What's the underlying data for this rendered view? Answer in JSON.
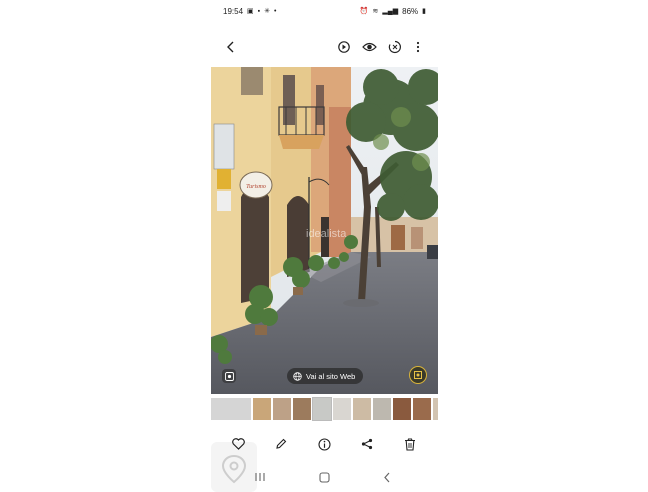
{
  "status_bar": {
    "time": "19:54",
    "battery": "86%"
  },
  "photo": {
    "watermark": "idealista",
    "web_button_label": "Vai al sito Web"
  },
  "thumbnails": {
    "count": 10,
    "active_index": 3
  },
  "top_bar": {
    "icons": [
      "back-icon",
      "rotate-icon",
      "eye-icon",
      "remaster-icon",
      "more-icon"
    ]
  },
  "action_bar": {
    "icons": [
      "heart-icon",
      "edit-icon",
      "info-icon",
      "share-icon",
      "delete-icon"
    ]
  },
  "nav_bar": {
    "icons": [
      "recents-icon",
      "home-icon",
      "back-icon"
    ]
  }
}
